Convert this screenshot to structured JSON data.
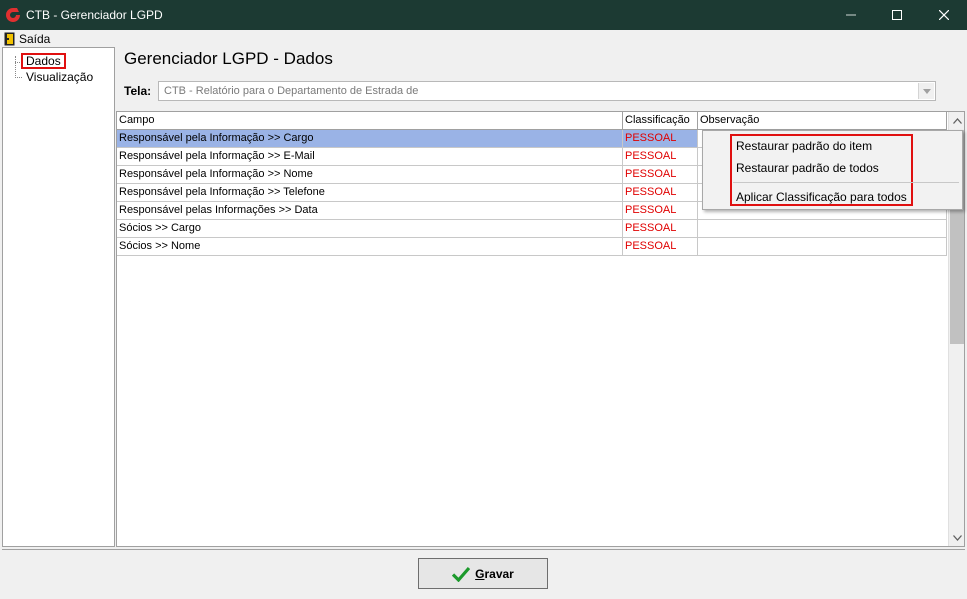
{
  "window": {
    "title": "CTB - Gerenciador LGPD",
    "title_bar_color": "#1c3a33"
  },
  "menu": {
    "exit_label": "Saída"
  },
  "tree": {
    "items": [
      {
        "label": "Dados"
      },
      {
        "label": "Visualização"
      }
    ]
  },
  "page": {
    "title": "Gerenciador LGPD - Dados"
  },
  "tela": {
    "label": "Tela:",
    "value": "CTB - Relatório para o Departamento de Estrada de"
  },
  "grid": {
    "columns": [
      "Campo",
      "Classificação",
      "Observação"
    ],
    "rows": [
      {
        "campo": "Responsável pela Informação >> Cargo",
        "classificacao": "PESSOAL",
        "observacao": ""
      },
      {
        "campo": "Responsável pela Informação >> E-Mail",
        "classificacao": "PESSOAL",
        "observacao": ""
      },
      {
        "campo": "Responsável pela Informação >> Nome",
        "classificacao": "PESSOAL",
        "observacao": ""
      },
      {
        "campo": "Responsável pela Informação >> Telefone",
        "classificacao": "PESSOAL",
        "observacao": ""
      },
      {
        "campo": "Responsável pelas Informações >> Data",
        "classificacao": "PESSOAL",
        "observacao": ""
      },
      {
        "campo": "Sócios >> Cargo",
        "classificacao": "PESSOAL",
        "observacao": ""
      },
      {
        "campo": "Sócios >> Nome",
        "classificacao": "PESSOAL",
        "observacao": ""
      }
    ],
    "selected_row_color": "#9ab3e6",
    "classification_color": "#e00000"
  },
  "context_menu": {
    "items": [
      "Restaurar padrão do item",
      "Restaurar padrão de todos",
      "Aplicar Classificação para todos"
    ]
  },
  "footer": {
    "save_prefix": "G",
    "save_rest": "ravar"
  },
  "colors": {
    "highlight_border": "#e01010",
    "check_green": "#1c9a2c"
  },
  "icons": [
    "app-logo-icon",
    "exit-door-icon",
    "minimize-icon",
    "maximize-icon",
    "close-icon",
    "dropdown-arrow-icon",
    "scroll-up-icon",
    "scroll-down-icon",
    "checkmark-icon"
  ]
}
